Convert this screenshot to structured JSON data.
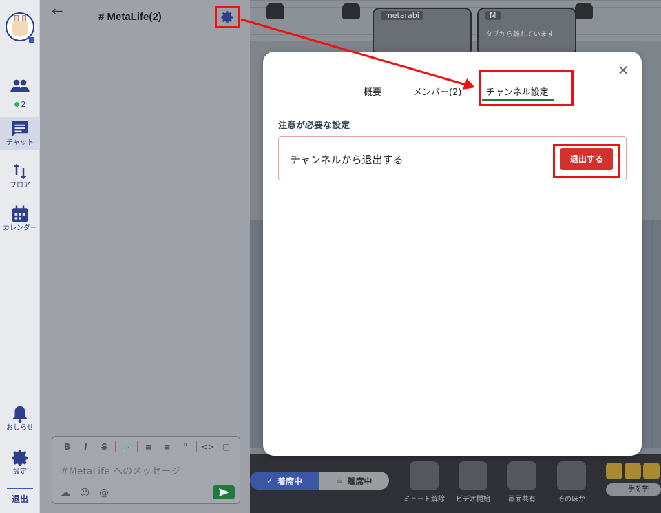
{
  "rail": {
    "members_label": "",
    "online_count": "2",
    "chat_label": "チャット",
    "floor_label": "フロア",
    "calendar_label": "カレンダー",
    "notify_label": "おしらせ",
    "settings_label": "設定",
    "exit_label": "退出"
  },
  "chat": {
    "title": "# MetaLife(2)",
    "placeholder": "#MetaLife へのメッセージ",
    "format_buttons": [
      "B",
      "I",
      "S",
      "🔗",
      "≡",
      "≡",
      "\"",
      "<>",
      "▢"
    ]
  },
  "space": {
    "tiles": [
      {
        "name": "metarabi",
        "message": ""
      },
      {
        "name": "M",
        "message": "タブから離れています"
      }
    ],
    "status_on": "着席中",
    "status_off": "離席中",
    "controls": [
      "ミュート解除",
      "ビデオ開始",
      "画面共有",
      "そのほか"
    ],
    "raise_hand": "手を挙"
  },
  "modal": {
    "tabs": [
      "概要",
      "メンバー(2)",
      "チャンネル設定"
    ],
    "active_tab": "チャンネル設定",
    "section_title": "注意が必要な設定",
    "leave_text": "チャンネルから退出する",
    "leave_button": "退出する"
  },
  "colors": {
    "highlight": "#ee1111",
    "accent": "#2e3e8a",
    "danger": "#d52f2f",
    "online": "#2db55d"
  }
}
